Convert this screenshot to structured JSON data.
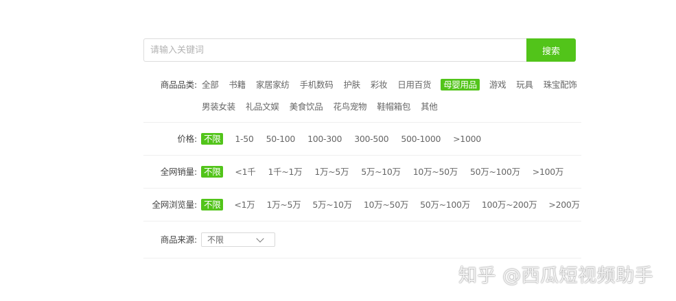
{
  "search": {
    "placeholder": "请输入关键词",
    "button_label": "搜索"
  },
  "filters": {
    "category": {
      "label": "商品品类:",
      "options": [
        "全部",
        "书籍",
        "家居家纺",
        "手机数码",
        "护肤",
        "彩妆",
        "日用百货",
        "母婴用品",
        "游戏",
        "玩具",
        "珠宝配饰",
        "男装女装",
        "礼品文娱",
        "美食饮品",
        "花鸟宠物",
        "鞋帽箱包",
        "其他"
      ],
      "selected": "母婴用品"
    },
    "price": {
      "label": "价格:",
      "options": [
        "不限",
        "1-50",
        "50-100",
        "100-300",
        "300-500",
        "500-1000",
        ">1000"
      ],
      "selected": "不限"
    },
    "sales": {
      "label": "全网销量:",
      "options": [
        "不限",
        "<1千",
        "1千~1万",
        "1万~5万",
        "5万~10万",
        "10万~50万",
        "50万~100万",
        ">100万"
      ],
      "selected": "不限"
    },
    "views": {
      "label": "全网浏览量:",
      "options": [
        "不限",
        "<1万",
        "1万~5万",
        "5万~10万",
        "10万~50万",
        "50万~100万",
        "100万~200万",
        ">200万"
      ],
      "selected": "不限"
    },
    "source": {
      "label": "商品来源:",
      "selected_value": "不限"
    }
  },
  "watermark": "知乎 @西瓜短视频助手",
  "colors": {
    "accent": "#52c41a",
    "divider": "#efefef",
    "text": "#666666"
  }
}
